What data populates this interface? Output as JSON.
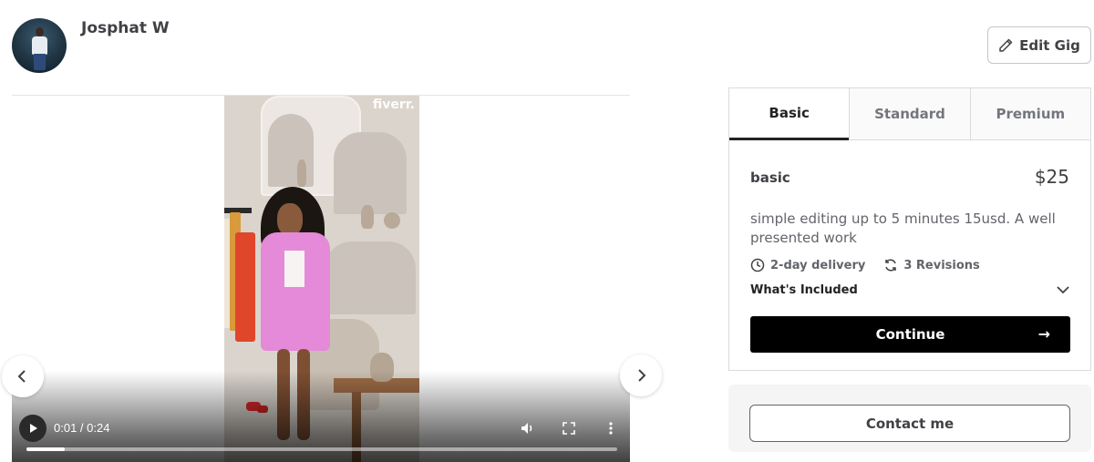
{
  "seller": {
    "name": "Josphat W",
    "edit_label": "Edit Gig"
  },
  "watermark": "fiverr.",
  "video": {
    "time": "0:01 / 0:24",
    "progress": 0.065
  },
  "packages": {
    "tabs": [
      "Basic",
      "Standard",
      "Premium"
    ],
    "active": "Basic",
    "name": "basic",
    "price": "$25",
    "description": "simple editing up to 5 minutes 15usd. A well presented work",
    "delivery": "2-day delivery",
    "revisions": "3 Revisions",
    "included_label": "What's Included",
    "continue_label": "Continue",
    "continue_arrow": "→"
  },
  "contact_label": "Contact me"
}
